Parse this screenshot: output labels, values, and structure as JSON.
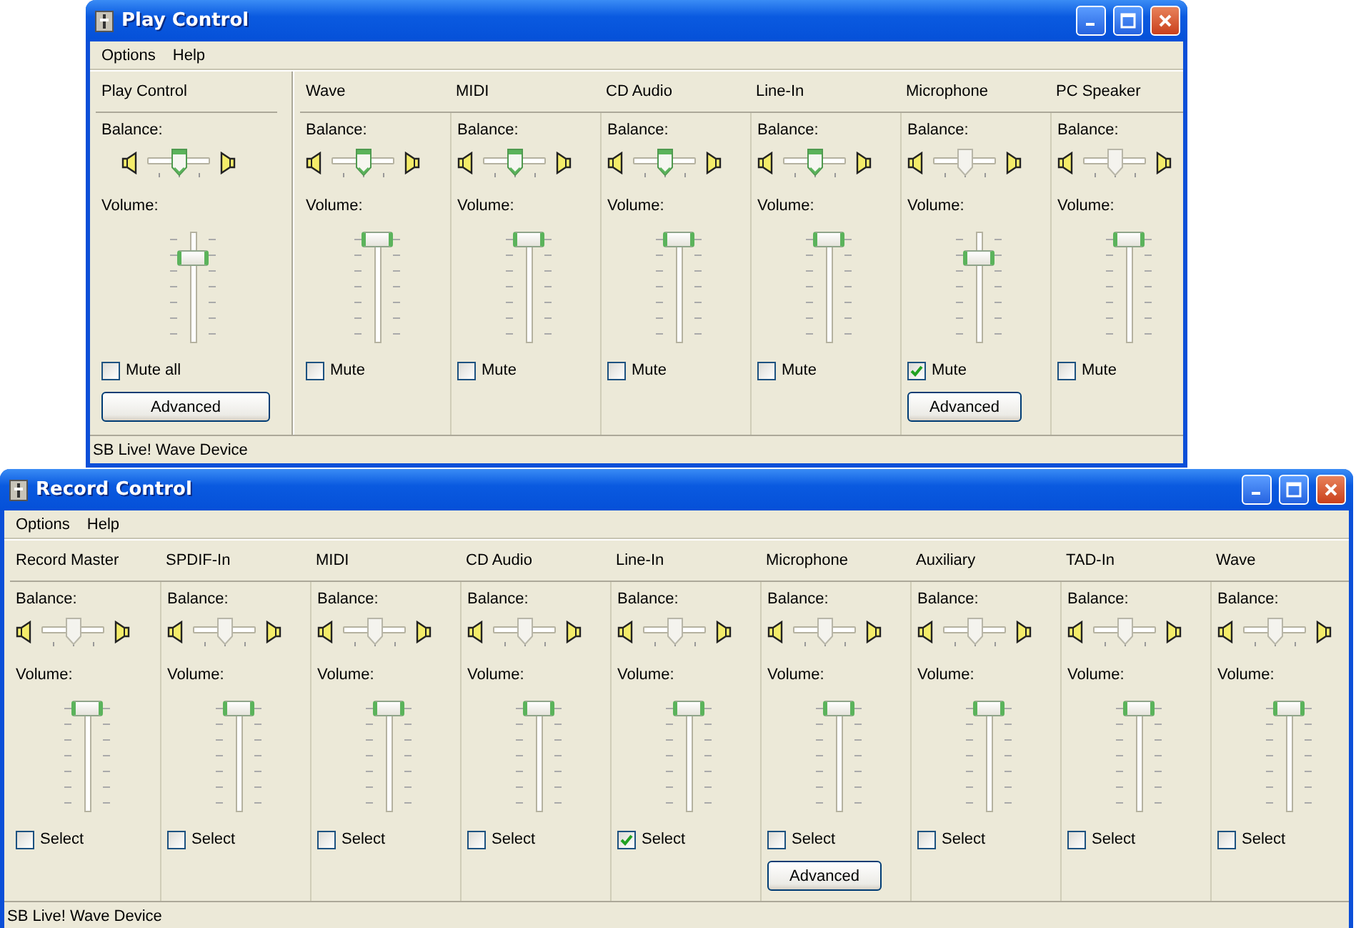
{
  "windows": [
    {
      "title": "Play Control",
      "menu": [
        "Options",
        "Help"
      ],
      "status": "SB Live! Wave Device",
      "master": {
        "name": "Play Control",
        "balance": {
          "label": "Balance:",
          "level": 0.5,
          "active": true
        },
        "volume": {
          "label": "Volume:",
          "level": 0.8
        },
        "checkbox": {
          "label": "Mute all",
          "checked": false
        },
        "advanced": "Advanced"
      },
      "lines": [
        {
          "name": "Wave",
          "balance": {
            "label": "Balance:",
            "level": 0.5,
            "active": true
          },
          "volume": {
            "label": "Volume:",
            "level": 1
          },
          "checkbox": {
            "label": "Mute",
            "checked": false
          }
        },
        {
          "name": "MIDI",
          "balance": {
            "label": "Balance:",
            "level": 0.5,
            "active": true
          },
          "volume": {
            "label": "Volume:",
            "level": 1
          },
          "checkbox": {
            "label": "Mute",
            "checked": false
          }
        },
        {
          "name": "CD Audio",
          "balance": {
            "label": "Balance:",
            "level": 0.5,
            "active": true
          },
          "volume": {
            "label": "Volume:",
            "level": 1
          },
          "checkbox": {
            "label": "Mute",
            "checked": false
          }
        },
        {
          "name": "Line-In",
          "balance": {
            "label": "Balance:",
            "level": 0.5,
            "active": true
          },
          "volume": {
            "label": "Volume:",
            "level": 1
          },
          "checkbox": {
            "label": "Mute",
            "checked": false
          }
        },
        {
          "name": "Microphone",
          "balance": {
            "label": "Balance:",
            "level": 0.5,
            "active": false
          },
          "volume": {
            "label": "Volume:",
            "level": 0.8
          },
          "checkbox": {
            "label": "Mute",
            "checked": true
          },
          "advanced": "Advanced"
        },
        {
          "name": "PC Speaker",
          "balance": {
            "label": "Balance:",
            "level": 0.5,
            "active": false
          },
          "volume": {
            "label": "Volume:",
            "level": 1
          },
          "checkbox": {
            "label": "Mute",
            "checked": false
          }
        }
      ]
    },
    {
      "title": "Record Control",
      "menu": [
        "Options",
        "Help"
      ],
      "status": "SB Live! Wave Device",
      "lines": [
        {
          "name": "Record Master",
          "balance": {
            "label": "Balance:",
            "level": 0.5,
            "active": false
          },
          "volume": {
            "label": "Volume:",
            "level": 1
          },
          "checkbox": {
            "label": "Select",
            "checked": false
          }
        },
        {
          "name": "SPDIF-In",
          "balance": {
            "label": "Balance:",
            "level": 0.5,
            "active": false
          },
          "volume": {
            "label": "Volume:",
            "level": 1
          },
          "checkbox": {
            "label": "Select",
            "checked": false
          }
        },
        {
          "name": "MIDI",
          "balance": {
            "label": "Balance:",
            "level": 0.5,
            "active": false
          },
          "volume": {
            "label": "Volume:",
            "level": 1
          },
          "checkbox": {
            "label": "Select",
            "checked": false
          }
        },
        {
          "name": "CD Audio",
          "balance": {
            "label": "Balance:",
            "level": 0.5,
            "active": false
          },
          "volume": {
            "label": "Volume:",
            "level": 1
          },
          "checkbox": {
            "label": "Select",
            "checked": false
          }
        },
        {
          "name": "Line-In",
          "balance": {
            "label": "Balance:",
            "level": 0.5,
            "active": false
          },
          "volume": {
            "label": "Volume:",
            "level": 1
          },
          "checkbox": {
            "label": "Select",
            "checked": true
          }
        },
        {
          "name": "Microphone",
          "balance": {
            "label": "Balance:",
            "level": 0.5,
            "active": false
          },
          "volume": {
            "label": "Volume:",
            "level": 1
          },
          "checkbox": {
            "label": "Select",
            "checked": false
          },
          "advanced": "Advanced"
        },
        {
          "name": "Auxiliary",
          "balance": {
            "label": "Balance:",
            "level": 0.5,
            "active": false
          },
          "volume": {
            "label": "Volume:",
            "level": 1
          },
          "checkbox": {
            "label": "Select",
            "checked": false
          }
        },
        {
          "name": "TAD-In",
          "balance": {
            "label": "Balance:",
            "level": 0.5,
            "active": false
          },
          "volume": {
            "label": "Volume:",
            "level": 1
          },
          "checkbox": {
            "label": "Select",
            "checked": false
          }
        },
        {
          "name": "Wave",
          "balance": {
            "label": "Balance:",
            "level": 0.5,
            "active": false
          },
          "volume": {
            "label": "Volume:",
            "level": 1
          },
          "checkbox": {
            "label": "Select",
            "checked": false
          }
        }
      ]
    }
  ]
}
